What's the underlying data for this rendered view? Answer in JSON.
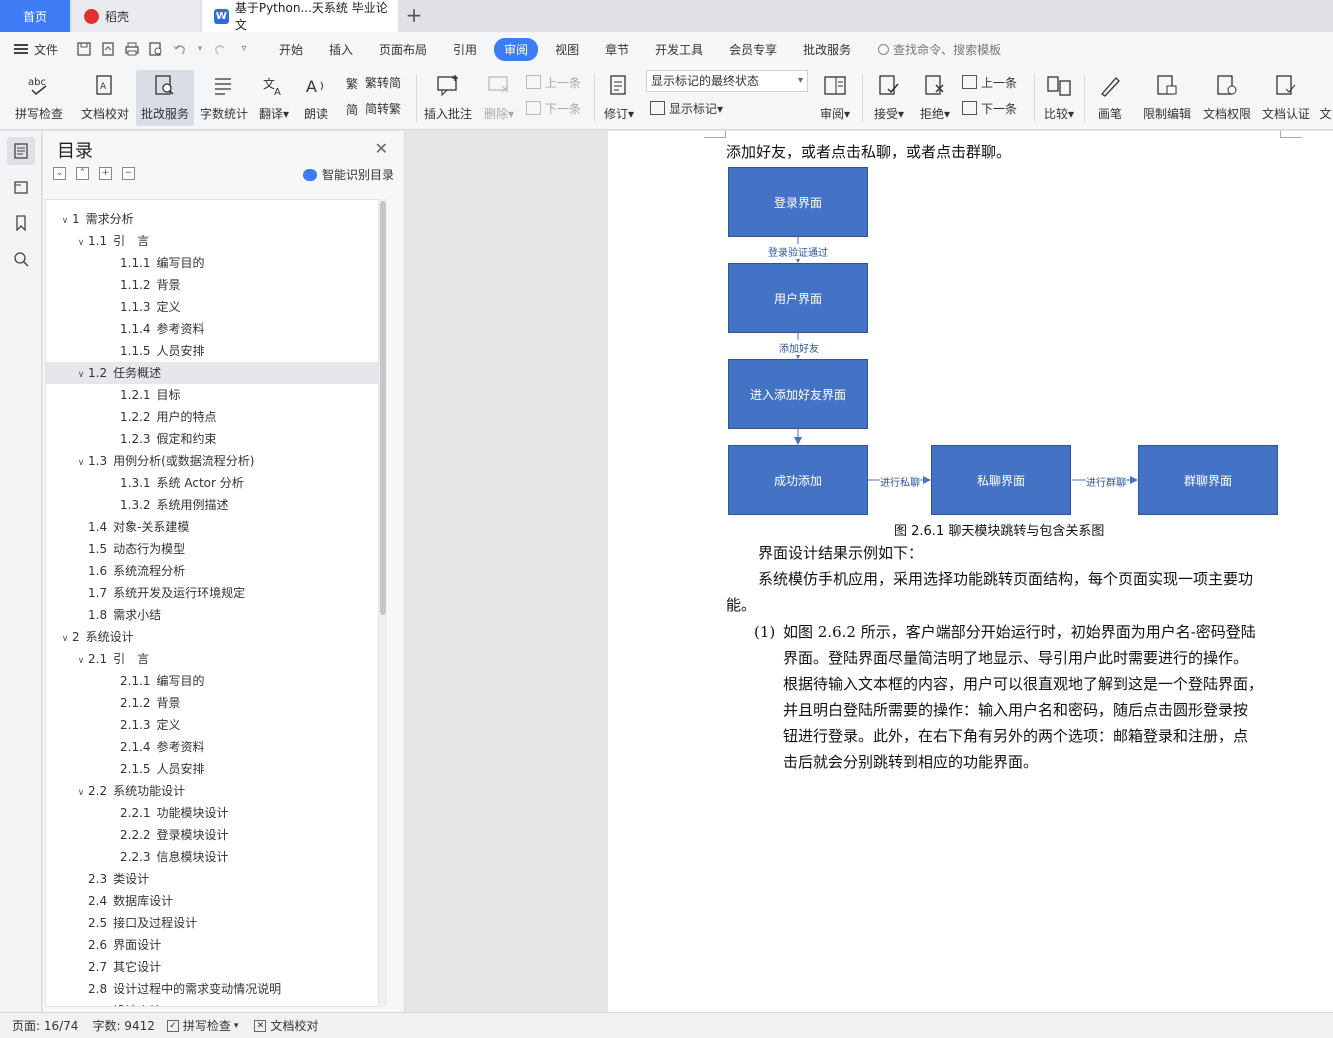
{
  "tabs": {
    "home": "首页",
    "daoke": "稻壳",
    "doc": "基于Python...天系统 毕业论文",
    "add": "+"
  },
  "menu": {
    "file": "文件",
    "items": [
      "开始",
      "插入",
      "页面布局",
      "引用",
      "审阅",
      "视图",
      "章节",
      "开发工具",
      "会员专享",
      "批改服务"
    ],
    "search_placeholder": "查找命令、搜索模板"
  },
  "ribbon": {
    "spellcheck": "拼写检查",
    "doc_proof": "文档校对",
    "review_service": "批改服务",
    "word_count": "字数统计",
    "translate": "翻译",
    "read_aloud": "朗读",
    "to_traditional": "繁转简",
    "to_simplified": "简转繁",
    "insert_comment": "插入批注",
    "delete": "删除",
    "prev_comment": "上一条",
    "next_comment": "下一条",
    "track_changes": "修订",
    "markup_state": "显示标记的最终状态",
    "show_markup": "显示标记",
    "review_pane": "审阅",
    "accept": "接受",
    "reject": "拒绝",
    "prev_change": "上一条",
    "next_change": "下一条",
    "compare": "比较",
    "ink": "画笔",
    "restrict_edit": "限制编辑",
    "doc_permission": "文档权限",
    "doc_certify": "文档认证",
    "more": "文"
  },
  "toc": {
    "title": "目录",
    "smart": "智能识别目录",
    "items": [
      {
        "num": "1",
        "text": "需求分析",
        "level": 1,
        "caret": "open"
      },
      {
        "num": "1.1",
        "text": "引　言",
        "level": 2,
        "caret": "open"
      },
      {
        "num": "1.1.1",
        "text": "编写目的",
        "level": 3
      },
      {
        "num": "1.1.2",
        "text": "背景",
        "level": 3
      },
      {
        "num": "1.1.3",
        "text": "定义",
        "level": 3
      },
      {
        "num": "1.1.4",
        "text": "参考资料",
        "level": 3
      },
      {
        "num": "1.1.5",
        "text": "人员安排",
        "level": 3
      },
      {
        "num": "1.2",
        "text": "任务概述",
        "level": 2,
        "caret": "open",
        "selected": true
      },
      {
        "num": "1.2.1",
        "text": "目标",
        "level": 3
      },
      {
        "num": "1.2.2",
        "text": "用户的特点",
        "level": 3
      },
      {
        "num": "1.2.3",
        "text": "假定和约束",
        "level": 3
      },
      {
        "num": "1.3",
        "text": "用例分析(或数据流程分析)",
        "level": 2,
        "caret": "open"
      },
      {
        "num": "1.3.1",
        "text": "系统 Actor 分析",
        "level": 3
      },
      {
        "num": "1.3.2",
        "text": "系统用例描述",
        "level": 3
      },
      {
        "num": "1.4",
        "text": "对象-关系建模",
        "level": 2
      },
      {
        "num": "1.5",
        "text": "动态行为模型",
        "level": 2
      },
      {
        "num": "1.6",
        "text": "系统流程分析",
        "level": 2
      },
      {
        "num": "1.7",
        "text": "系统开发及运行环境规定",
        "level": 2
      },
      {
        "num": "1.8",
        "text": "需求小结",
        "level": 2
      },
      {
        "num": "2",
        "text": "系统设计",
        "level": 1,
        "caret": "open"
      },
      {
        "num": "2.1",
        "text": "引　言",
        "level": 2,
        "caret": "open"
      },
      {
        "num": "2.1.1",
        "text": "编写目的",
        "level": 3
      },
      {
        "num": "2.1.2",
        "text": "背景",
        "level": 3
      },
      {
        "num": "2.1.3",
        "text": "定义",
        "level": 3
      },
      {
        "num": "2.1.4",
        "text": "参考资料",
        "level": 3
      },
      {
        "num": "2.1.5",
        "text": "人员安排",
        "level": 3
      },
      {
        "num": "2.2",
        "text": "系统功能设计",
        "level": 2,
        "caret": "open"
      },
      {
        "num": "2.2.1",
        "text": "功能模块设计",
        "level": 3
      },
      {
        "num": "2.2.2",
        "text": "登录模块设计",
        "level": 3
      },
      {
        "num": "2.2.3",
        "text": "信息模块设计",
        "level": 3
      },
      {
        "num": "2.3",
        "text": "类设计",
        "level": 2
      },
      {
        "num": "2.4",
        "text": "数据库设计",
        "level": 2
      },
      {
        "num": "2.5",
        "text": "接口及过程设计",
        "level": 2
      },
      {
        "num": "2.6",
        "text": "界面设计",
        "level": 2
      },
      {
        "num": "2.7",
        "text": "其它设计",
        "level": 2
      },
      {
        "num": "2.8",
        "text": "设计过程中的需求变动情况说明",
        "level": 2
      },
      {
        "num": "2.9",
        "text": "设计小结",
        "level": 2
      }
    ]
  },
  "doc": {
    "line_top": "添加好友，或者点击私聊，或者点击群聊。",
    "flow": {
      "login": "登录界面",
      "user": "用户界面",
      "add_friend": "进入添加好友界面",
      "success": "成功添加",
      "private": "私聊界面",
      "group": "群聊界面",
      "edge_login": "登录验证通过",
      "edge_add": "添加好友",
      "edge_private": "进行私聊",
      "edge_group": "进行群聊"
    },
    "caption": "图 2.6.1  聊天模块跳转与包含关系图",
    "para1": "界面设计结果示例如下：",
    "para2_a": "系统模仿手机应用，采用选择功能跳转页面结构，每个页面实现一项主要功",
    "para2_b": "能。",
    "item_num": "(1)",
    "item_lines": [
      "如图 2.6.2 所示，客户端部分开始运行时，初始界面为用户名-密码登陆",
      "界面。登陆界面尽量简洁明了地显示、导引用户此时需要进行的操作。",
      "根据待输入文本框的内容，用户可以很直观地了解到这是一个登陆界面，",
      "并且明白登陆所需要的操作：输入用户名和密码，随后点击圆形登录按",
      "钮进行登录。此外，在右下角有另外的两个选项：邮箱登录和注册，点",
      "击后就会分别跳转到相应的功能界面。"
    ]
  },
  "status": {
    "page": "页面: 16/74",
    "words": "字数: 9412",
    "spellcheck": "拼写检查",
    "proof": "文档校对"
  },
  "colors": {
    "accent": "#3d7cf4",
    "flow_fill": "#4472c4"
  }
}
